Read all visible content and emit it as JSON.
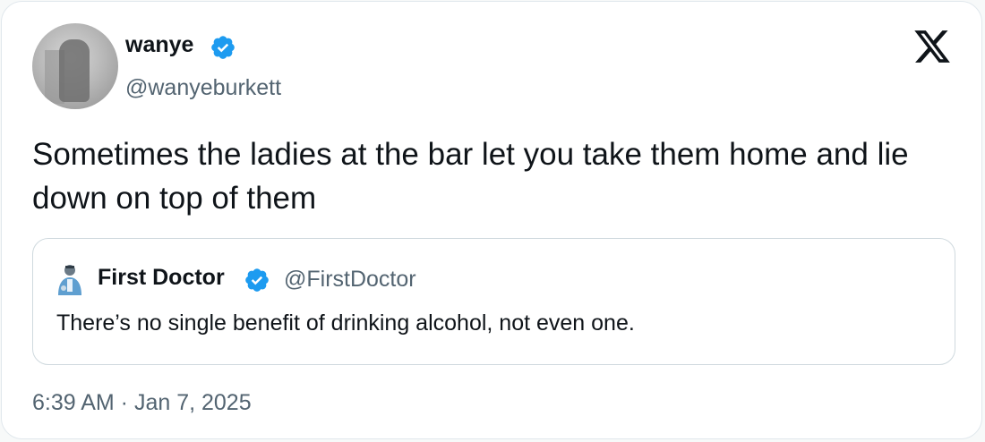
{
  "author": {
    "display_name": "wanye",
    "handle": "@wanyeburkett",
    "verified": true
  },
  "tweet": {
    "text": "Sometimes the ladies at the bar let you take them home and lie down on top of them",
    "timestamp": "6:39 AM · Jan 7, 2025"
  },
  "quoted_tweet": {
    "display_name": "First Doctor",
    "handle": "@FirstDoctor",
    "verified": true,
    "text": "There’s no single benefit of drinking alcohol, not even one."
  },
  "icons": {
    "platform_logo": "x-logo-icon",
    "verified_badge": "verified-badge-icon"
  },
  "colors": {
    "verified_blue": "#1d9bf0",
    "text_primary": "#0f1419",
    "text_secondary": "#536471",
    "border": "#cfd9de"
  }
}
